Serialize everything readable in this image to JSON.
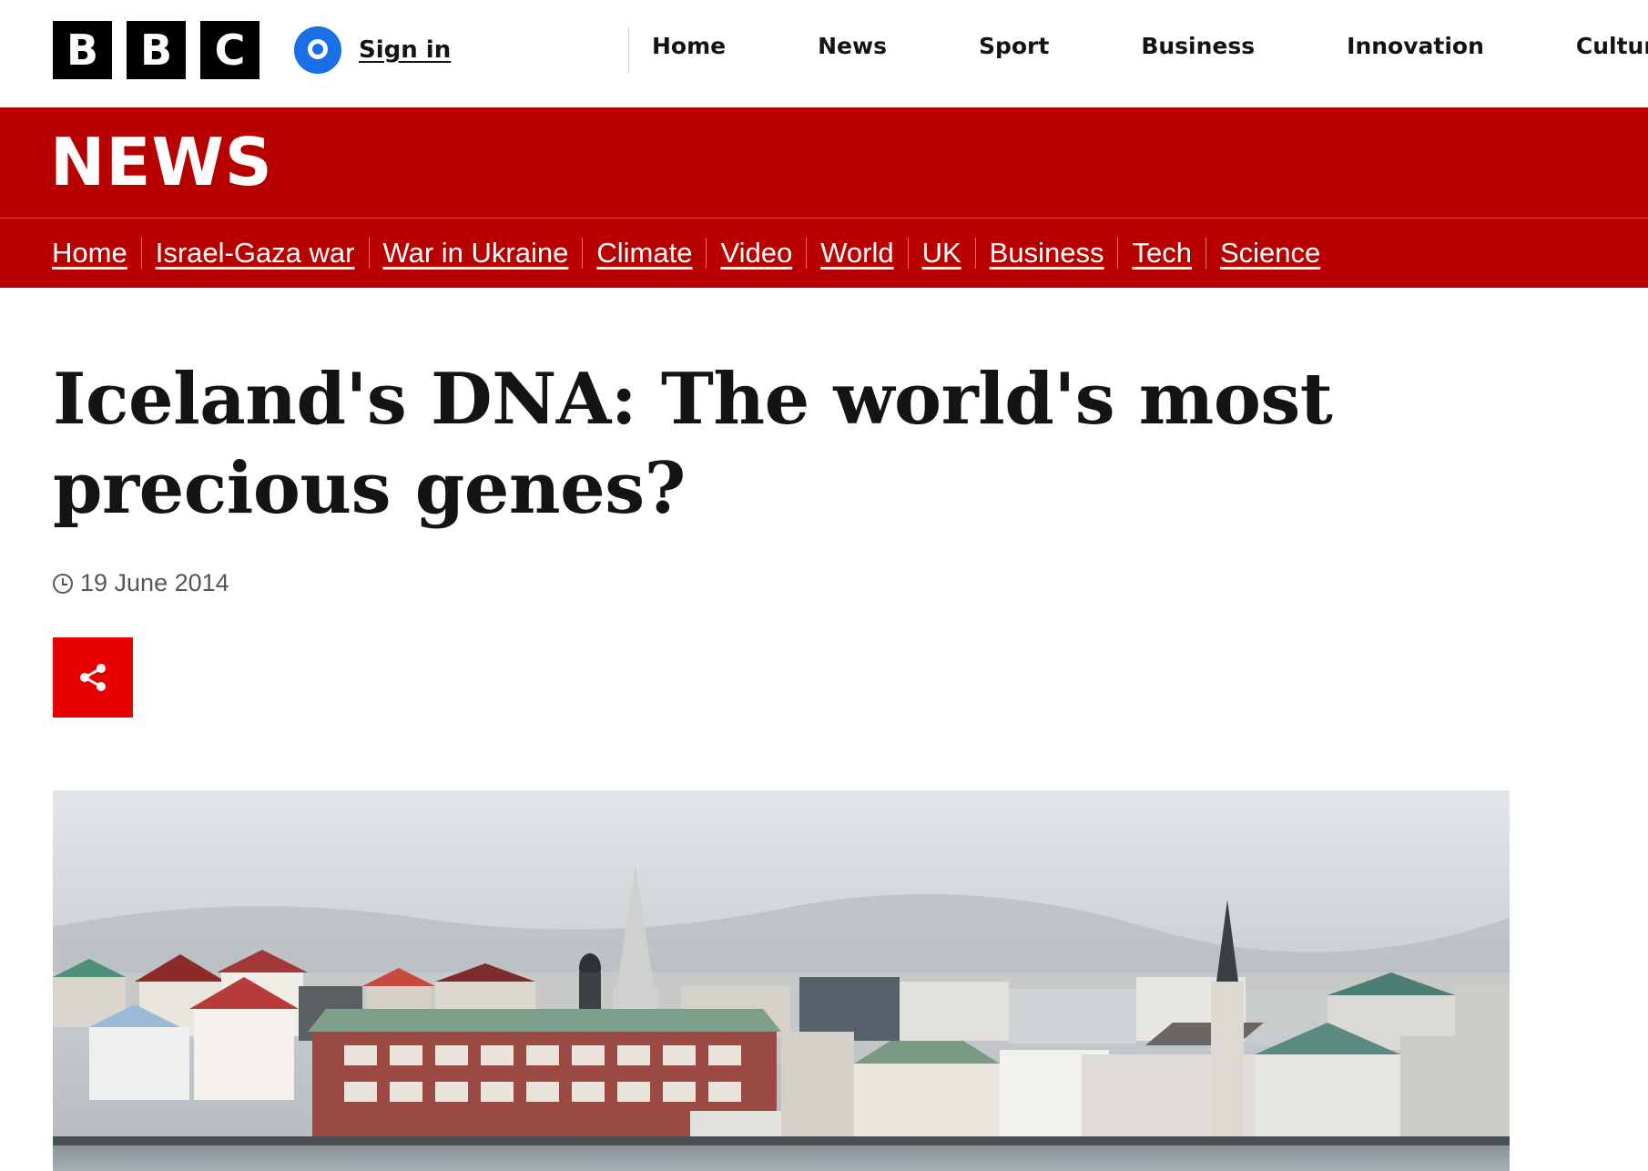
{
  "topbar": {
    "logo_letters": [
      "B",
      "B",
      "C"
    ],
    "signin_label": "Sign in",
    "nav": [
      "Home",
      "News",
      "Sport",
      "Business",
      "Innovation",
      "Culture"
    ]
  },
  "news_band": {
    "wordmark": "NEWS"
  },
  "subnav": {
    "items": [
      "Home",
      "Israel-Gaza war",
      "War in Ukraine",
      "Climate",
      "Video",
      "World",
      "UK",
      "Business",
      "Tech",
      "Science"
    ]
  },
  "article": {
    "headline": "Iceland's DNA: The world's most precious genes?",
    "date": "19 June 2014"
  },
  "icons": {
    "signin": "user-icon",
    "date": "clock-icon",
    "share": "share-icon"
  },
  "colors": {
    "news_red": "#b80000",
    "share_red": "#e60000",
    "signin_blue": "#1a6ee6"
  }
}
